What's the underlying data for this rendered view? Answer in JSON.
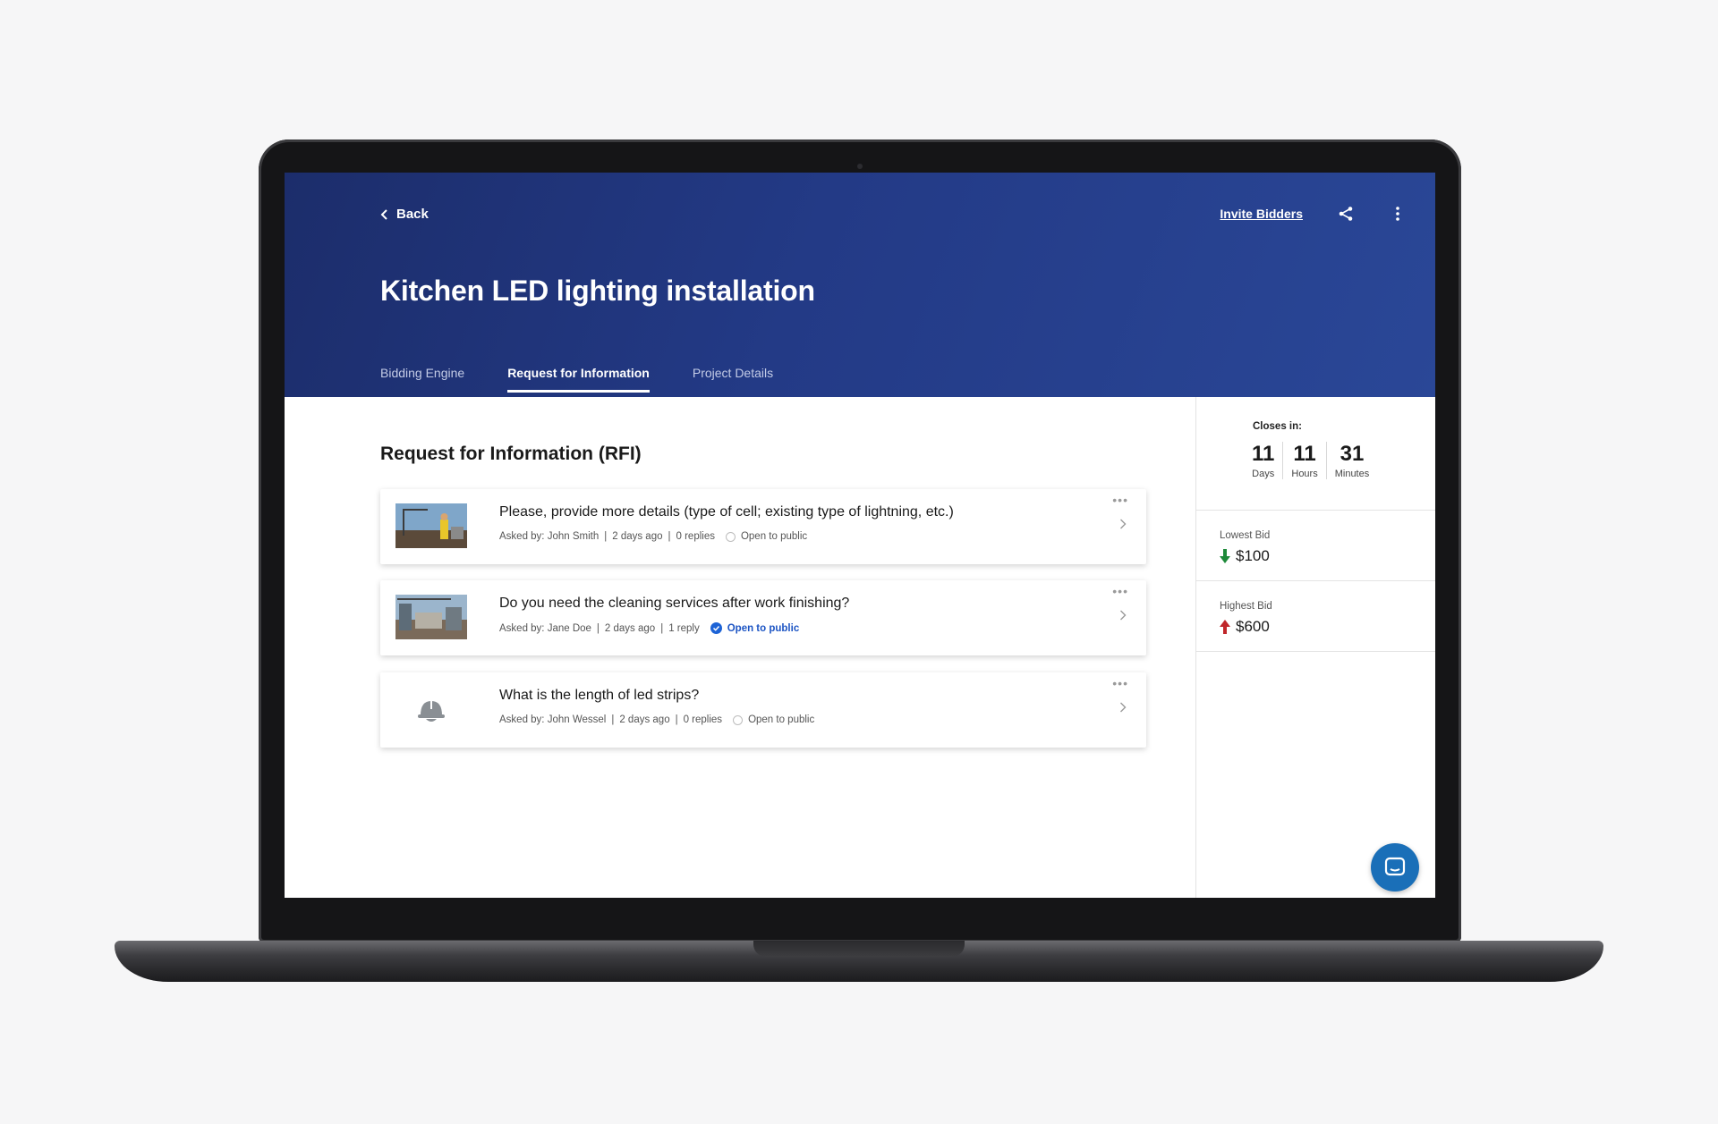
{
  "header": {
    "back_label": "Back",
    "invite_label": "Invite Bidders",
    "title": "Kitchen LED lighting installation",
    "tabs": [
      {
        "label": "Bidding Engine"
      },
      {
        "label": "Request for Information"
      },
      {
        "label": "Project Details"
      }
    ],
    "active_tab": "Request for Information"
  },
  "main": {
    "section_title": "Request for Information (RFI)",
    "rfis": [
      {
        "question": "Please, provide more details (type of cell; existing type of lightning, etc.)",
        "asked_by": "Asked by: John Smith",
        "age": "2 days ago",
        "replies": "0 replies",
        "public_label": "Open to public",
        "public": false,
        "thumb": "construction-worker-photo"
      },
      {
        "question": "Do you need the cleaning services after work finishing?",
        "asked_by": "Asked by: Jane Doe",
        "age": "2 days ago",
        "replies": "1 reply",
        "public_label": "Open to public",
        "public": true,
        "thumb": "construction-site-photo"
      },
      {
        "question": "What is the length of led strips?",
        "asked_by": "Asked by: John Wessel",
        "age": "2 days ago",
        "replies": "0 replies",
        "public_label": "Open to public",
        "public": false,
        "thumb": "hard-hat-icon"
      }
    ]
  },
  "sidebar": {
    "closes_label": "Closes in:",
    "countdown": [
      {
        "value": "11",
        "unit": "Days"
      },
      {
        "value": "11",
        "unit": "Hours"
      },
      {
        "value": "31",
        "unit": "Minutes"
      }
    ],
    "lowest": {
      "label": "Lowest Bid",
      "value": "$100"
    },
    "highest": {
      "label": "Highest Bid",
      "value": "$600"
    }
  },
  "colors": {
    "hero": "#233a86",
    "accent": "#1d63d6",
    "fab": "#1a6fb8",
    "down_arrow": "#1e8a3a",
    "up_arrow": "#c0262a"
  }
}
